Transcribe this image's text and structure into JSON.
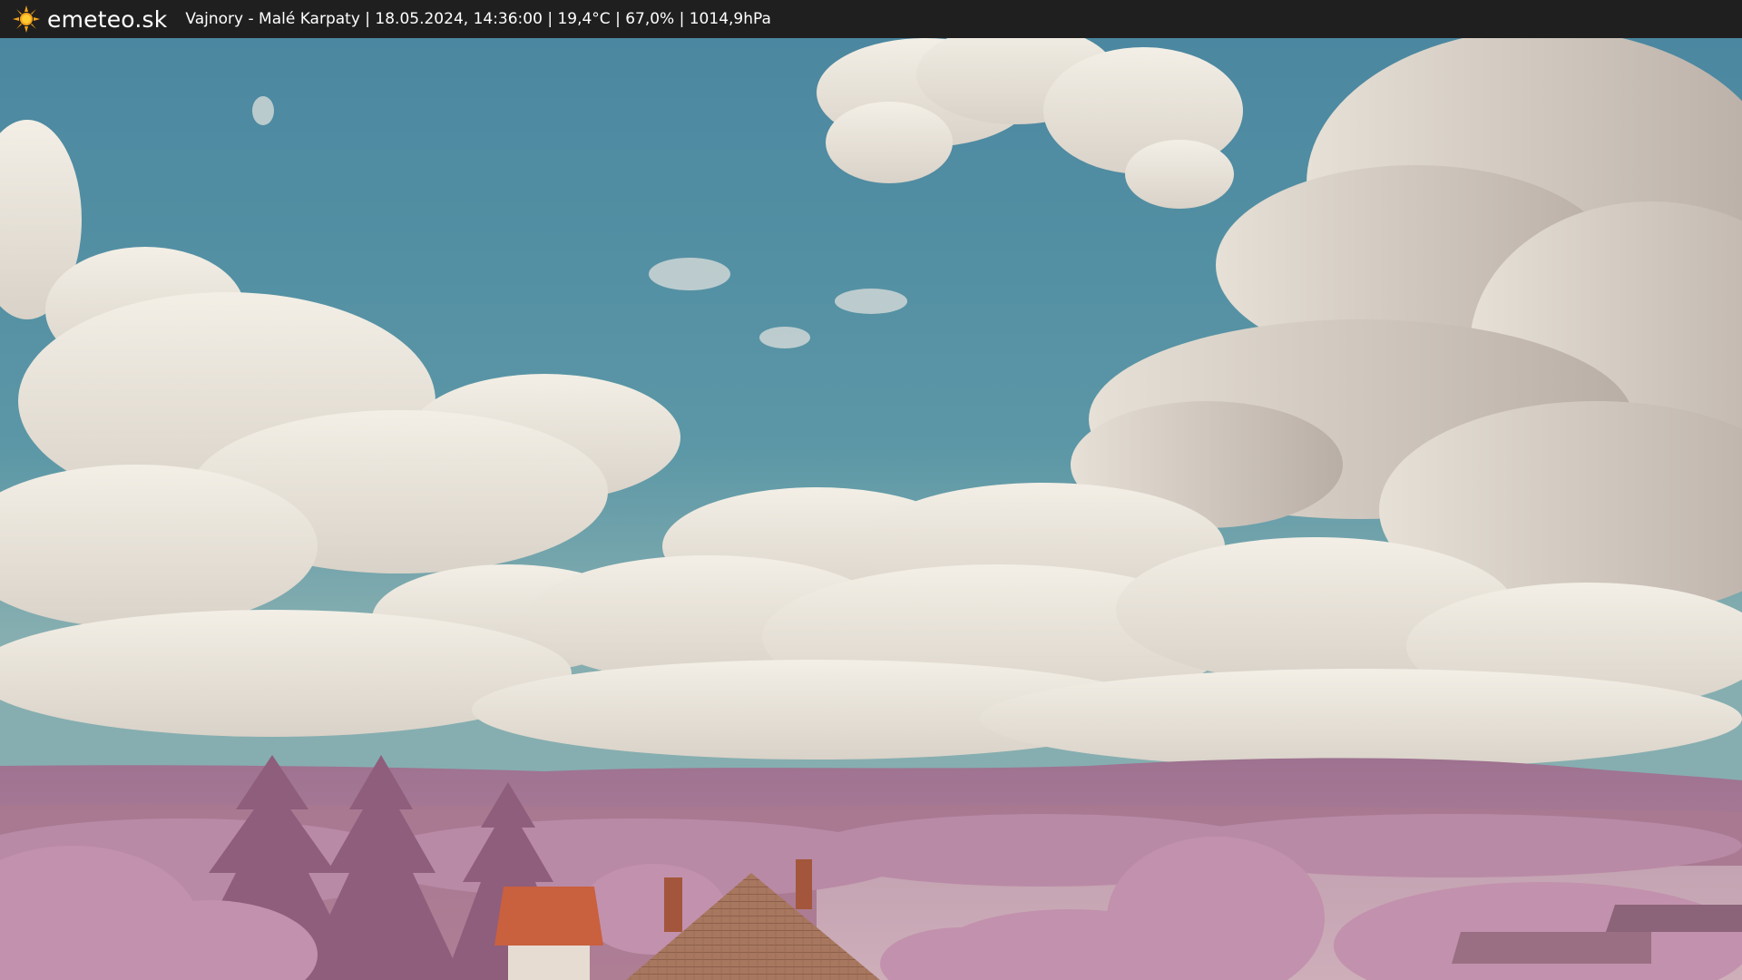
{
  "header": {
    "logo_icon": "sun-icon",
    "brand": "emeteo.sk",
    "caption": "Vajnory - Malé Karpaty | 18.05.2024, 14:36:00 | 19,4°C | 67,0% | 1014,9hPa"
  },
  "colors": {
    "bar": "#1f1f1f",
    "sky": "#4f8ea0",
    "cloud": "#efeae0",
    "foliage": "#b57d9e",
    "roof": "#c9603e"
  }
}
